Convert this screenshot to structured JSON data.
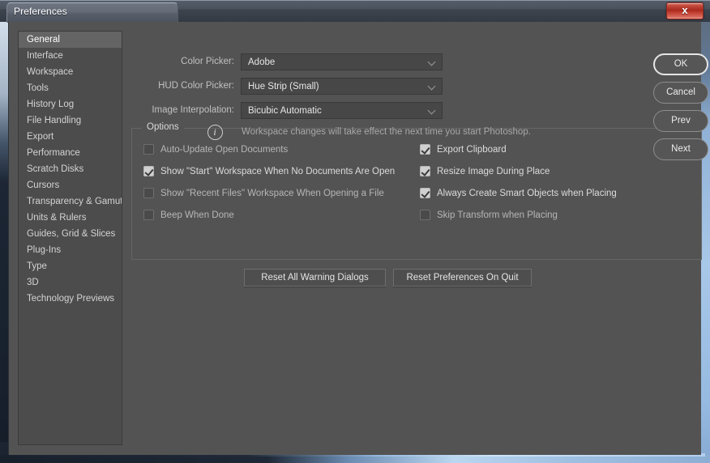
{
  "window": {
    "title": "Preferences",
    "close_label": "x",
    "close_icon": "close-icon",
    "accent_close": "#a8271c",
    "body_bg": "#535353"
  },
  "sidebar": {
    "selected_index": 0,
    "items": [
      {
        "label": "General"
      },
      {
        "label": "Interface"
      },
      {
        "label": "Workspace"
      },
      {
        "label": "Tools"
      },
      {
        "label": "History Log"
      },
      {
        "label": "File Handling"
      },
      {
        "label": "Export"
      },
      {
        "label": "Performance"
      },
      {
        "label": "Scratch Disks"
      },
      {
        "label": "Cursors"
      },
      {
        "label": "Transparency & Gamut"
      },
      {
        "label": "Units & Rulers"
      },
      {
        "label": "Guides, Grid & Slices"
      },
      {
        "label": "Plug-Ins"
      },
      {
        "label": "Type"
      },
      {
        "label": "3D"
      },
      {
        "label": "Technology Previews"
      }
    ]
  },
  "fields": [
    {
      "label": "Color Picker:",
      "value": "Adobe"
    },
    {
      "label": "HUD Color Picker:",
      "value": "Hue Strip (Small)"
    },
    {
      "label": "Image Interpolation:",
      "value": "Bicubic Automatic"
    }
  ],
  "options": {
    "legend": "Options",
    "left_column": [
      {
        "label": "Auto-Update Open Documents",
        "checked": false
      },
      {
        "label": "Show \"Start\" Workspace When No Documents Are Open",
        "checked": true
      },
      {
        "label": "Show \"Recent Files\" Workspace When Opening a File",
        "checked": false
      },
      {
        "label": "Beep When Done",
        "checked": false
      }
    ],
    "right_column": [
      {
        "label": "Export Clipboard",
        "checked": true
      },
      {
        "label": "Resize Image During Place",
        "checked": true
      },
      {
        "label": "Always Create Smart Objects when Placing",
        "checked": true
      },
      {
        "label": "Skip Transform when Placing",
        "checked": false
      }
    ],
    "info": {
      "icon": "info-icon",
      "glyph": "i",
      "text": "Workspace changes will take effect the next time you start Photoshop."
    }
  },
  "reset_buttons": [
    {
      "label": "Reset All Warning Dialogs"
    },
    {
      "label": "Reset Preferences On Quit"
    }
  ],
  "actions": [
    {
      "label": "OK",
      "primary": true
    },
    {
      "label": "Cancel",
      "primary": false
    },
    {
      "label": "Prev",
      "primary": false
    },
    {
      "label": "Next",
      "primary": false
    }
  ]
}
